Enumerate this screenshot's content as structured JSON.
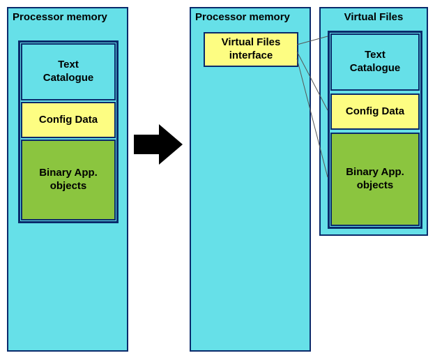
{
  "left": {
    "title": "Processor memory",
    "text_catalogue": "Text\nCatalogue",
    "config_data": "Config Data",
    "binary_objects": "Binary App.\nobjects"
  },
  "middle": {
    "title": "Processor memory",
    "vf_interface": "Virtual Files\ninterface"
  },
  "right": {
    "title": "Virtual Files",
    "text_catalogue": "Text\nCatalogue",
    "config_data": "Config Data",
    "binary_objects": "Binary App.\nobjects"
  }
}
